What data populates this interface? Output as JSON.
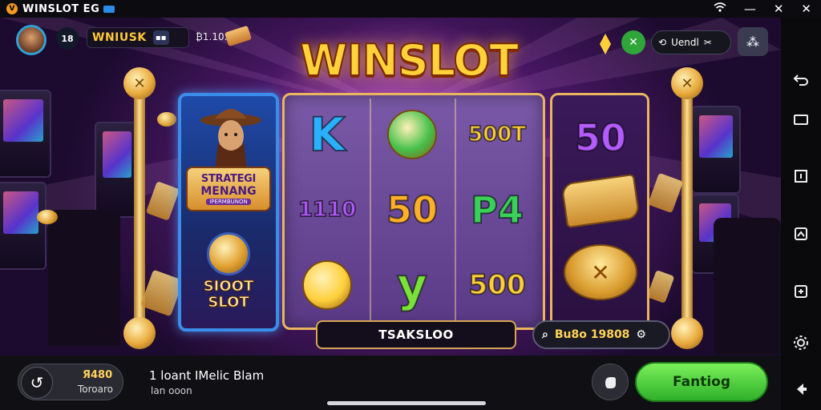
{
  "status_bar": {
    "app_title": "WINSLOT EG",
    "icons": [
      "wifi-icon",
      "minimize-icon",
      "close-icon",
      "window-close-icon"
    ]
  },
  "hud": {
    "player_badge": "18",
    "player_name": "WNIUSK",
    "player_small": "₿1.10.",
    "hud_pill_text": "Uendl",
    "title": "WINSLOT"
  },
  "left_card": {
    "banner_line1": "STRATEGI",
    "banner_line2": "MENANG",
    "banner_line3": "IPERMBUNON",
    "slot_line1": "SIOOT",
    "slot_line2": "SLOT"
  },
  "reels": {
    "symbols": [
      {
        "text": "K",
        "color": "#2ab0ff"
      },
      {
        "text": "",
        "color": "#46c04a"
      },
      {
        "text": "500T",
        "color": "#ffcf3a"
      },
      {
        "text": "1110",
        "color": "#b45cff"
      },
      {
        "text": "50",
        "color": "#ffb02a"
      },
      {
        "text": "P4",
        "color": "#3ad05a"
      },
      {
        "text": "",
        "color": "#ffcf3a"
      },
      {
        "text": "y",
        "color": "#7ae03a"
      },
      {
        "text": "500",
        "color": "#ffcf3a"
      }
    ],
    "right_top": "50"
  },
  "in_game_bar": {
    "label": "TSAKSLOO",
    "search_text": "Bu8o 19808"
  },
  "bottom_bar": {
    "back_value": "Я480",
    "back_sub": "Toroaro",
    "info_main": "1 loant IMelic Blam",
    "info_sub": "lan ooon",
    "go_button": "Fantiog"
  },
  "colors": {
    "accent_gold": "#ffd23a",
    "go_green": "#2fb02a",
    "card_blue": "#3a8de8"
  }
}
